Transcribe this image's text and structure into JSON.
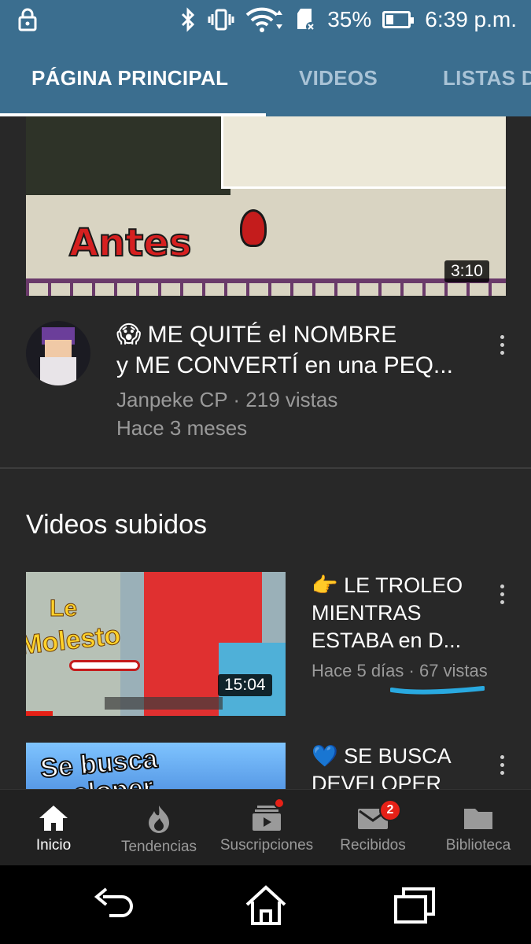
{
  "status_bar": {
    "battery_percent": "35%",
    "battery_level": 0.35,
    "time": "6:39 p.m.",
    "icons": [
      "lock-icon",
      "bluetooth-icon",
      "vibrate-icon",
      "wifi-icon",
      "sd-card-icon",
      "battery-icon"
    ]
  },
  "tabs": [
    {
      "label": "PÁGINA PRINCIPAL",
      "active": true
    },
    {
      "label": "VIDEOS",
      "active": false
    },
    {
      "label": "LISTAS D",
      "active": false
    }
  ],
  "featured": {
    "thumbnail_text": "Antes",
    "duration": "3:10",
    "title_line1": "😱 ME QUITÉ el NOMBRE",
    "title_line2": "y ME CONVERTÍ en una PEQ...",
    "channel_views": "Janpeke CP · 219 vistas",
    "age": "Hace 3 meses"
  },
  "uploads": {
    "section_title": "Videos subidos",
    "items": [
      {
        "thumbnail_text_1": "Le",
        "thumbnail_text_2": "Molesto",
        "duration": "15:04",
        "title_line1": "👉 LE TROLEO",
        "title_line2": "MIENTRAS",
        "title_line3": "ESTABA en D...",
        "meta": "Hace 5 días · 67 vistas"
      },
      {
        "thumbnail_text_1": "Se busca",
        "thumbnail_text_2": "eloper",
        "title_line1": "💙 SE BUSCA",
        "title_line2": "DEVELOPER"
      }
    ]
  },
  "bottom_nav": [
    {
      "label": "Inicio",
      "icon": "home-icon",
      "active": true
    },
    {
      "label": "Tendencias",
      "icon": "flame-icon",
      "active": false
    },
    {
      "label": "Suscripciones",
      "icon": "subscriptions-icon",
      "active": false
    },
    {
      "label": "Recibidos",
      "icon": "mail-icon",
      "active": false,
      "badge": "2"
    },
    {
      "label": "Biblioteca",
      "icon": "folder-icon",
      "active": false
    }
  ],
  "system_nav": [
    "back-icon",
    "home-outline-icon",
    "recents-icon"
  ]
}
